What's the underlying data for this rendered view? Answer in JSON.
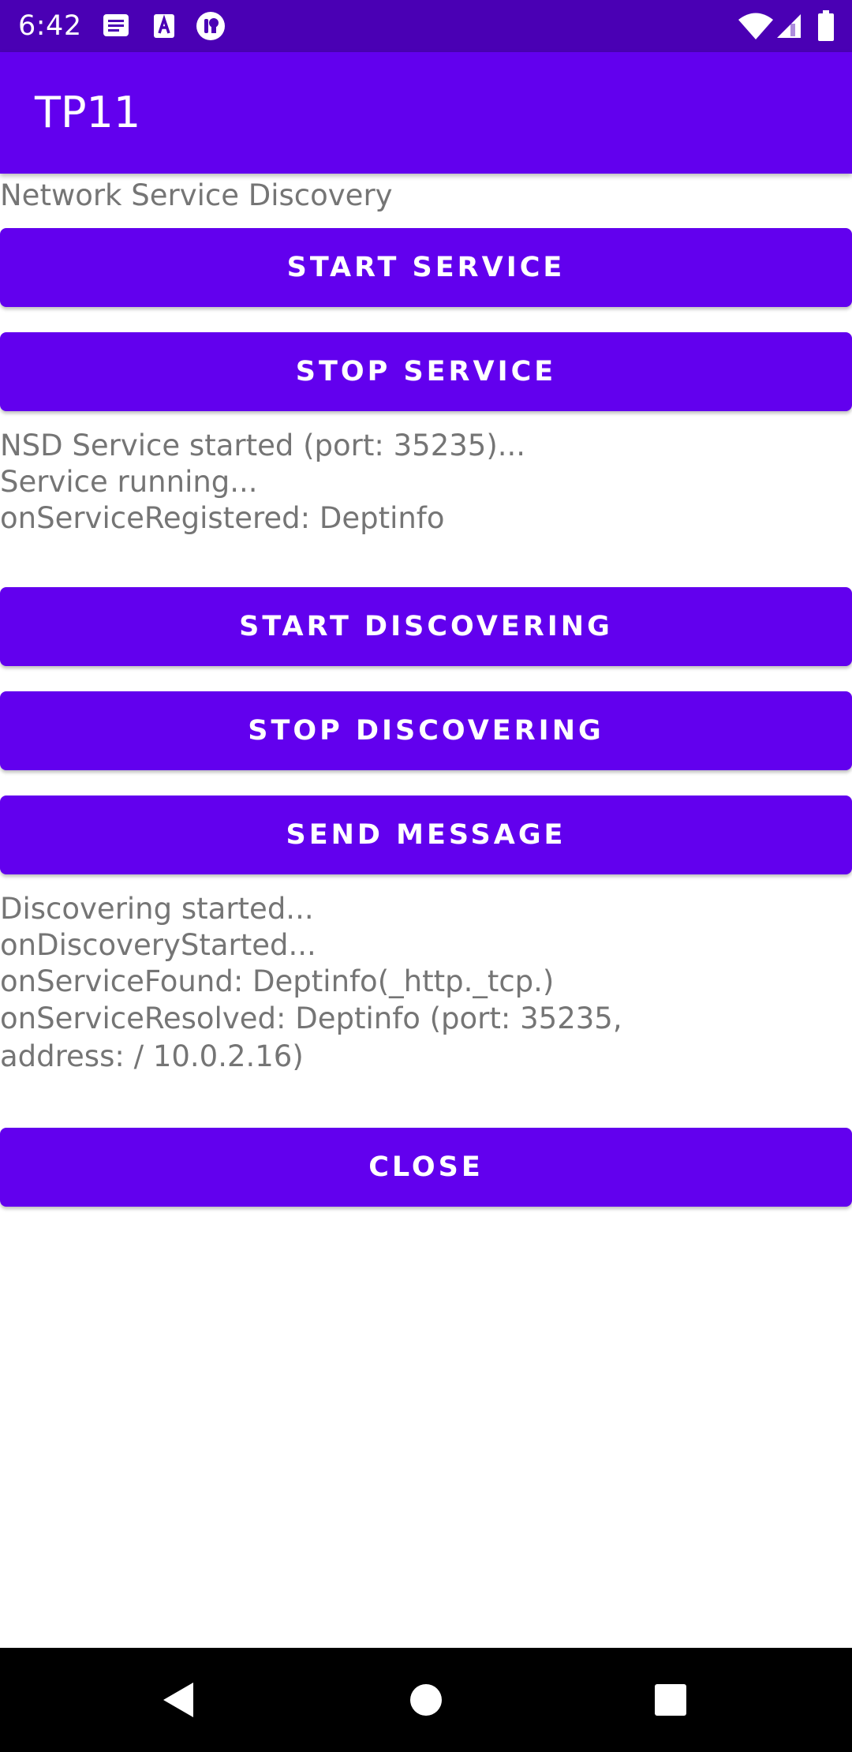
{
  "status_bar": {
    "time": "6:42",
    "left_icons": [
      "notification-messages-icon",
      "notification-font-icon",
      "notification-app-icon"
    ],
    "right_icons": [
      "wifi-icon",
      "cellular-signal-icon",
      "battery-icon"
    ],
    "background": "#4a00b4"
  },
  "app_bar": {
    "title": "TP11",
    "background": "#6200ee"
  },
  "main": {
    "subtitle": "Network Service Discovery",
    "buttons": {
      "start_service": "START SERVICE",
      "stop_service": "STOP SERVICE",
      "start_discovering": "START DISCOVERING",
      "stop_discovering": "STOP DISCOVERING",
      "send_message": "SEND MESSAGE",
      "close": "CLOSE"
    },
    "service_log": [
      "NSD Service started (port: 35235)...",
      "Service running...",
      "onServiceRegistered: Deptinfo"
    ],
    "discovery_log": [
      "Discovering started...",
      "onDiscoveryStarted...",
      "onServiceFound: Deptinfo(_http._tcp.)",
      "onServiceResolved: Deptinfo (port: 35235, address: / 10.0.2.16)"
    ],
    "accent_color": "#6200ee",
    "text_color": "#757575"
  },
  "nav_bar": {
    "icons": [
      "back-icon",
      "home-icon",
      "recents-icon"
    ]
  }
}
